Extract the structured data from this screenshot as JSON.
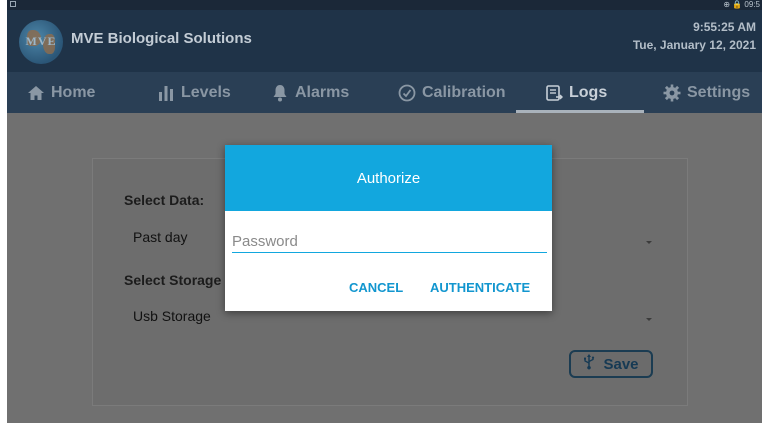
{
  "status_bar": {
    "right_text": "⊕ 🔒 09:5"
  },
  "app": {
    "logo_text": "MVE",
    "title": "MVE Biological Solutions",
    "time": "9:55:25 AM",
    "date": "Tue, January 12, 2021"
  },
  "tabs": [
    {
      "label": "Home",
      "icon": "home-icon"
    },
    {
      "label": "Levels",
      "icon": "bar-chart-icon"
    },
    {
      "label": "Alarms",
      "icon": "bell-icon"
    },
    {
      "label": "Calibration",
      "icon": "check-circle-icon"
    },
    {
      "label": "Logs",
      "icon": "log-export-icon",
      "active": true
    },
    {
      "label": "Settings",
      "icon": "gear-icon"
    }
  ],
  "form": {
    "select_data_label": "Select Data:",
    "select_data_value": "Past day",
    "select_storage_label": "Select Storage",
    "select_storage_value": "Usb Storage",
    "save_label": "Save",
    "save_icon": "usb-icon"
  },
  "dialog": {
    "title": "Authorize",
    "password_placeholder": "Password",
    "password_value": "",
    "cancel_label": "CANCEL",
    "authenticate_label": "AUTHENTICATE"
  },
  "colors": {
    "header_bg": "#1f3348",
    "dialog_accent": "#12a7de",
    "button_text": "#1296cf"
  }
}
